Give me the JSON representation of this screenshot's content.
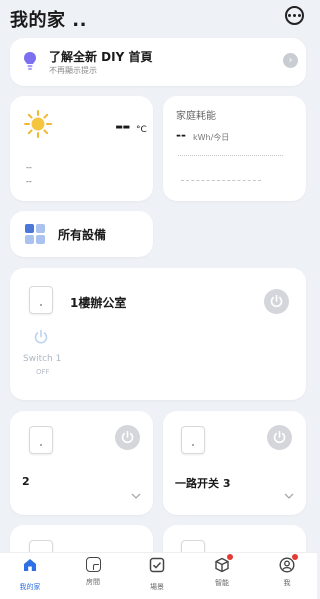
{
  "header": {
    "title": "我的家 .."
  },
  "banner": {
    "title": "了解全新 DIY 首頁",
    "subtitle": "不再顯示提示",
    "arrow": "›"
  },
  "weather": {
    "temperature": "--",
    "unit": "°C",
    "line1": "--",
    "line2": "--"
  },
  "energy": {
    "title": "家庭耗能",
    "value": "--",
    "unit": "kWh/今日"
  },
  "all_devices": {
    "label": "所有設備"
  },
  "room": {
    "name": "1樓辦公室",
    "switch": {
      "label": "Switch 1",
      "state": "OFF"
    }
  },
  "devices": [
    {
      "name": "2"
    },
    {
      "name": "一路开关 3"
    }
  ],
  "nav": {
    "items": [
      {
        "label": "我的家",
        "active": true
      },
      {
        "label": "房間"
      },
      {
        "label": "場景"
      },
      {
        "label": "智能",
        "badge": true
      },
      {
        "label": "我",
        "badge": true
      }
    ]
  },
  "colors": {
    "accent": "#2f6fe5",
    "badge": "#e53935",
    "grid_icon": [
      "#4b77d8",
      "#aac2f0",
      "#aac2f0",
      "#aac2f0"
    ]
  }
}
